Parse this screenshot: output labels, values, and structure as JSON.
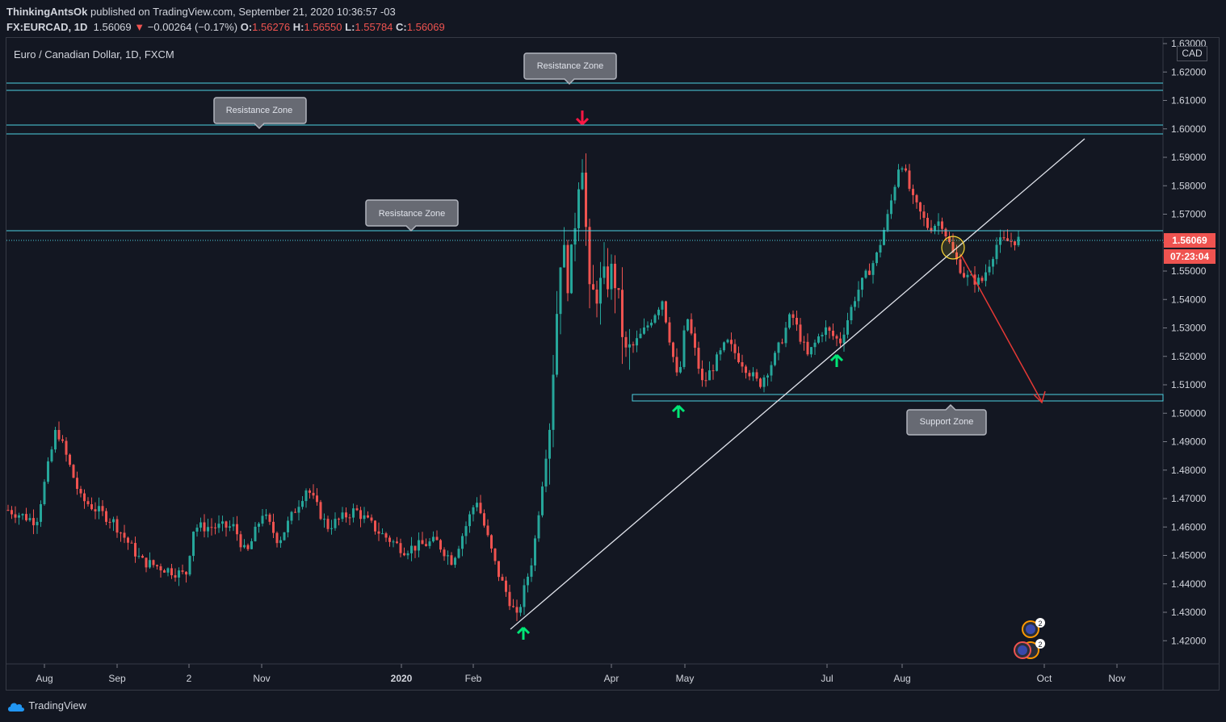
{
  "header": {
    "author": "ThinkingAntsOk",
    "published_text": "published on TradingView.com, September 21, 2020 10:36:57 -03",
    "symbol": "FX:EURCAD, 1D",
    "last": "1.56069",
    "change": "−0.00264 (−0.17%)",
    "o_label": "O:",
    "o_value": "1.56276",
    "h_label": "H:",
    "h_value": "1.56550",
    "l_label": "L:",
    "l_value": "1.55784",
    "c_label": "C:",
    "c_value": "1.56069",
    "change_arrow": "▼"
  },
  "chart": {
    "title": "Euro / Canadian Dollar, 1D, FXCM",
    "currency": "CAD",
    "price_badge": "1.56069",
    "countdown_badge": "07:23:04",
    "price_axis": [
      "1.63000",
      "1.62000",
      "1.61000",
      "1.60000",
      "1.59000",
      "1.58000",
      "1.57000",
      "1.56000",
      "1.55000",
      "1.54000",
      "1.53000",
      "1.52000",
      "1.51000",
      "1.50000",
      "1.49000",
      "1.48000",
      "1.47000",
      "1.46000",
      "1.45000",
      "1.44000",
      "1.43000",
      "1.42000"
    ],
    "time_axis": [
      "Aug",
      "Sep",
      "2",
      "Nov",
      "2020",
      "Feb",
      "Apr",
      "May",
      "Jul",
      "Aug",
      "Oct",
      "Nov"
    ],
    "annotations": [
      "Resistance Zone",
      "Resistance Zone",
      "Resistance Zone",
      "Support Zone"
    ],
    "event_badge_count": "2",
    "event_badge_count_2": "2",
    "colors": {
      "up": "#26a69a",
      "down": "#ef5350",
      "zone": "#4dd0e1",
      "background": "#131722"
    }
  },
  "footer": {
    "brand": "TradingView"
  }
}
